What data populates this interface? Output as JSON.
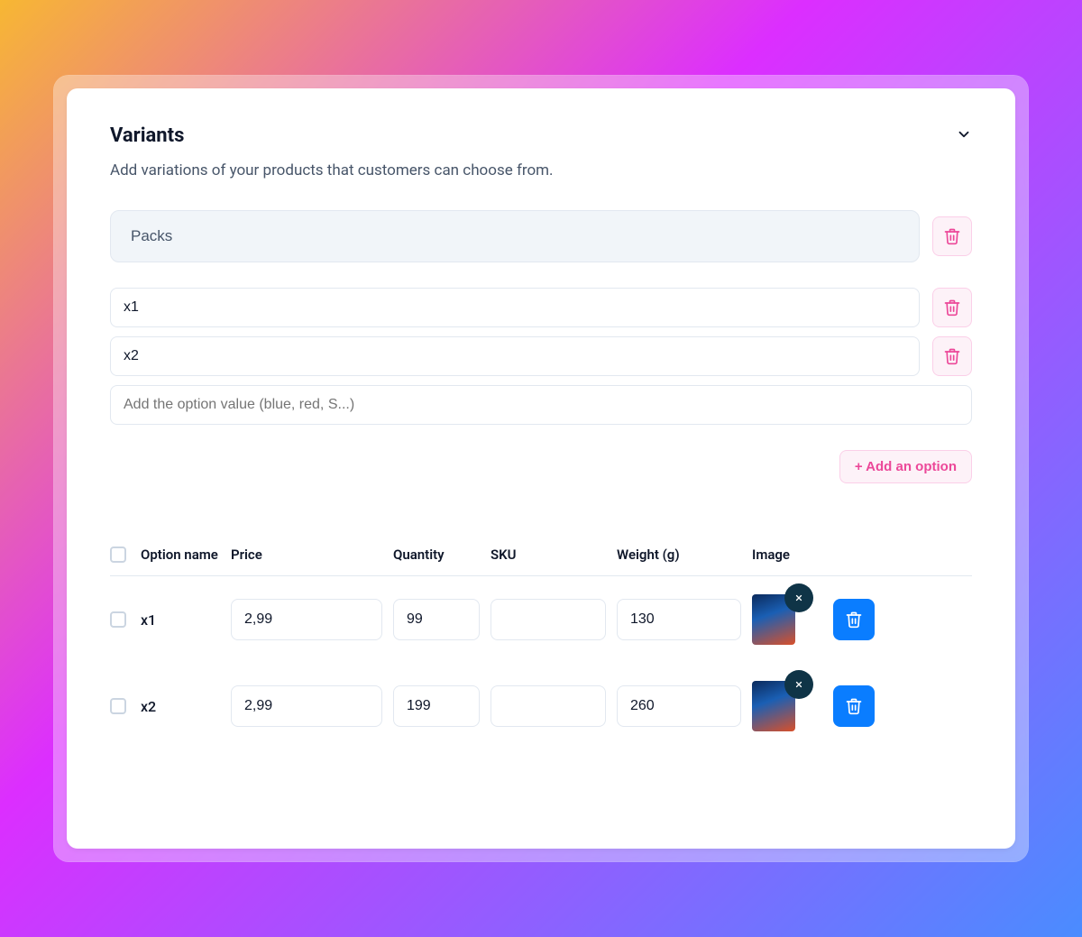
{
  "section": {
    "title": "Variants",
    "description": "Add variations of your products that customers can choose from."
  },
  "option": {
    "name": "Packs",
    "values": [
      "x1",
      "x2"
    ],
    "new_value_placeholder": "Add the option value (blue, red, S...)"
  },
  "actions": {
    "add_option_label": "+ Add an option"
  },
  "table": {
    "headers": {
      "option_name": "Option name",
      "price": "Price",
      "quantity": "Quantity",
      "sku": "SKU",
      "weight": "Weight (g)",
      "image": "Image"
    },
    "rows": [
      {
        "name": "x1",
        "price": "2,99",
        "quantity": "99",
        "sku": "",
        "weight": "130"
      },
      {
        "name": "x2",
        "price": "2,99",
        "quantity": "199",
        "sku": "",
        "weight": "260"
      }
    ]
  }
}
